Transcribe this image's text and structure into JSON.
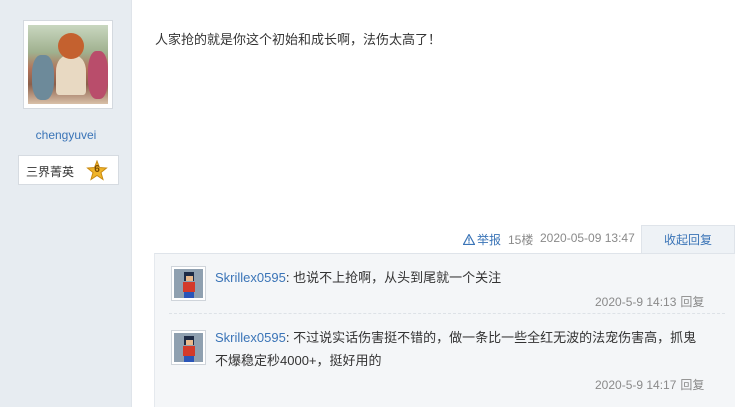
{
  "author": {
    "username": "chengyuvei",
    "rank_title": "三界菁英",
    "rank_level": "6"
  },
  "post": {
    "content": "人家抢的就是你这个初始和成长啊，法伤太高了！",
    "report_label": "举报",
    "floor": "15楼",
    "timestamp": "2020-05-09 13:47",
    "collapse_reply_label": "收起回复"
  },
  "replies": [
    {
      "user": "Skrillex0595",
      "separator": ": ",
      "text": "也说不上抢啊，从头到尾就一个关注",
      "time": "2020-5-9 14:13",
      "reply_label": "回复"
    },
    {
      "user": "Skrillex0595",
      "separator": ": ",
      "text": "不过说实话伤害挺不错的，做一条比一些全红无波的法宠伤害高，抓鬼不爆稳定秒4000+，挺好用的",
      "time": "2020-5-9 14:17",
      "reply_label": "回复"
    }
  ],
  "colors": {
    "link": "#3a74b7",
    "sidebar_bg": "#e7ecf1",
    "reply_area_bg": "#f4f6f8"
  },
  "icons": {
    "report": "warning-triangle-icon",
    "rank": "star-badge-icon"
  }
}
